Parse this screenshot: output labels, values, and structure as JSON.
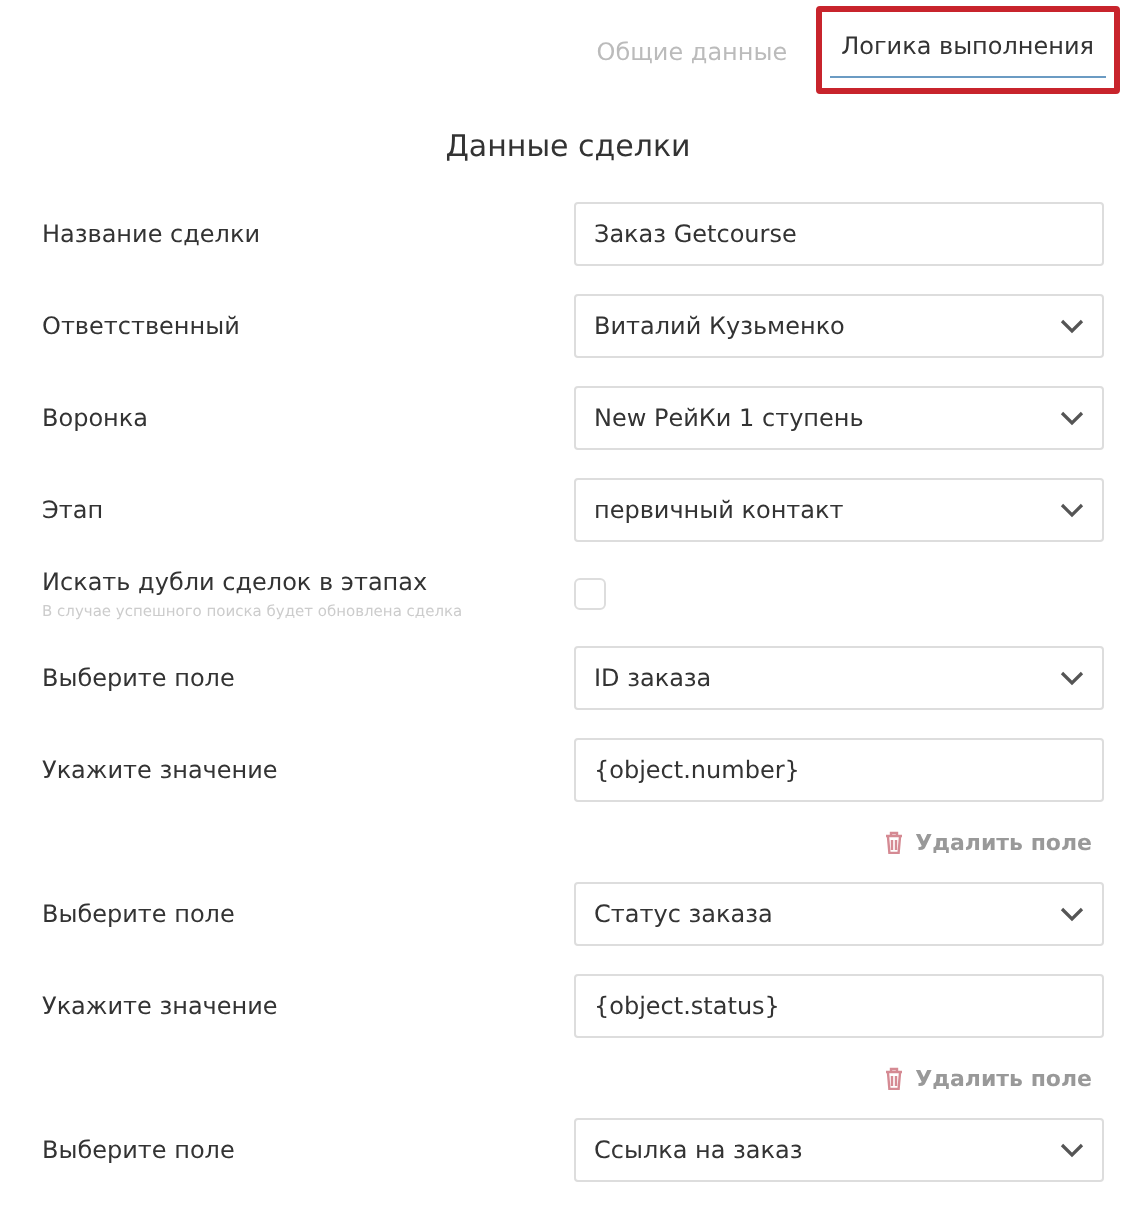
{
  "tabs": [
    {
      "label": "Общие данные",
      "selected": false,
      "highlighted": false
    },
    {
      "label": "Логика выполнения",
      "selected": true,
      "highlighted": true
    }
  ],
  "section_title": "Данные сделки",
  "rows": [
    {
      "kind": "text",
      "label": "Название сделки",
      "value": "Заказ Getcourse"
    },
    {
      "kind": "select",
      "label": "Ответственный",
      "value": "Виталий Кузьменко"
    },
    {
      "kind": "select",
      "label": "Воронка",
      "value": "New РейКи 1 ступень"
    },
    {
      "kind": "select",
      "label": "Этап",
      "value": "первичный контакт"
    },
    {
      "kind": "checkbox",
      "label": "Искать дубли сделок в этапах",
      "hint": "В случае успешного поиска будет обновлена сделка",
      "checked": false
    },
    {
      "kind": "select",
      "label": "Выберите поле",
      "value": "ID заказа"
    },
    {
      "kind": "text",
      "label": "Укажите значение",
      "value": "{object.number}"
    },
    {
      "kind": "delete",
      "label": "Удалить поле"
    },
    {
      "kind": "select",
      "label": "Выберите поле",
      "value": "Статус заказа"
    },
    {
      "kind": "text",
      "label": "Укажите значение",
      "value": "{object.status}"
    },
    {
      "kind": "delete",
      "label": "Удалить поле"
    },
    {
      "kind": "select",
      "label": "Выберите поле",
      "value": "Ссылка на заказ"
    }
  ]
}
